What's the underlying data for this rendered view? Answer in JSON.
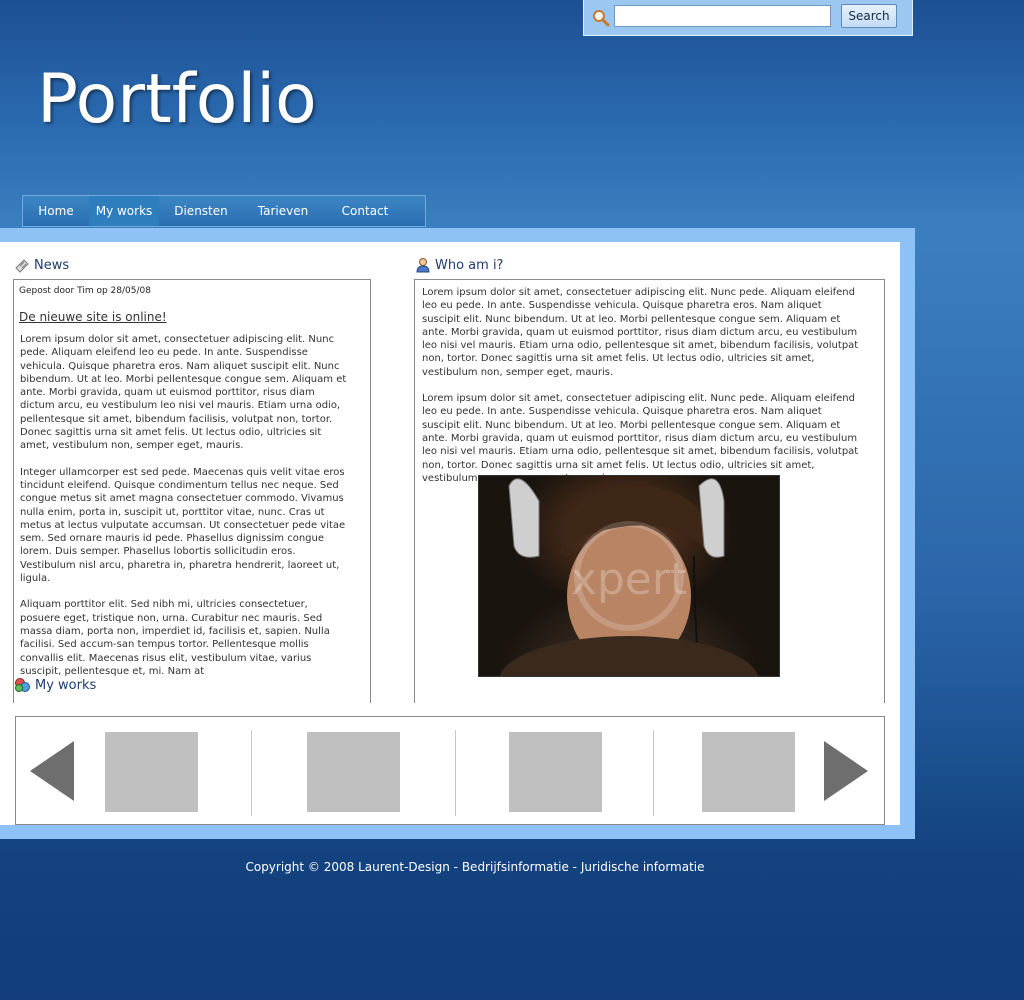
{
  "search": {
    "placeholder": "",
    "value": "",
    "button_label": "Search"
  },
  "site": {
    "title": "Portfolio"
  },
  "nav": {
    "items": [
      {
        "label": "Home"
      },
      {
        "label": "My works"
      },
      {
        "label": "Diensten"
      },
      {
        "label": "Tarieven"
      },
      {
        "label": "Contact"
      }
    ],
    "active": "My works"
  },
  "news": {
    "title": "News",
    "meta": "Gepost door Tim op 28/05/08",
    "headline": "De nieuwe site is online!",
    "paragraphs": [
      "Lorem ipsum dolor sit amet, consectetuer adipiscing elit. Nunc pede. Aliquam eleifend leo eu pede. In ante. Suspendisse vehicula. Quisque pharetra eros. Nam aliquet suscipit elit. Nunc bibendum. Ut at leo. Morbi pellentesque congue sem. Aliquam et ante. Morbi gravida, quam ut euismod porttitor, risus diam dictum arcu, eu vestibulum leo nisi vel mauris. Etiam urna odio, pellentesque sit amet, bibendum facilisis, volutpat non, tortor. Donec sagittis urna sit amet felis. Ut lectus odio, ultricies sit amet, vestibulum non, semper eget, mauris.",
      "Integer ullamcorper est sed pede. Maecenas quis velit vitae eros tincidunt eleifend. Quisque condimentum tellus nec neque. Sed congue metus sit amet magna consectetuer commodo. Vivamus nulla enim, porta in, suscipit ut, porttitor vitae, nunc. Cras ut metus at lectus vulputate accumsan. Ut consectetuer pede vitae sem. Sed ornare mauris id pede. Phasellus dignissim congue lorem. Duis semper. Phasellus lobortis sollicitudin eros. Vestibulum nisl arcu, pharetra in, pharetra hendrerit, laoreet ut, ligula.",
      "Aliquam porttitor elit. Sed nibh mi, ultricies consectetuer, posuere eget, tristique non, urna. Curabitur nec mauris. Sed massa diam, porta non, imperdiet id, facilisis et, sapien. Nulla facilisi. Sed accum-san tempus tortor. Pellentesque mollis convallis elit. Maecenas risus elit, vestibulum vitae, varius suscipit, pellentesque et, mi. Nam at"
    ]
  },
  "who": {
    "title": "Who am i?",
    "paragraphs": [
      "Lorem ipsum dolor sit amet, consectetuer adipiscing elit. Nunc pede. Aliquam eleifend leo eu pede. In ante. Suspendisse vehicula. Quisque pharetra eros. Nam aliquet suscipit elit. Nunc bibendum. Ut at leo. Morbi pellentesque congue sem. Aliquam et ante. Morbi gravida, quam ut euismod porttitor, risus diam dictum arcu, eu vestibulum leo nisi vel mauris. Etiam urna odio, pellentesque sit amet, bibendum facilisis, volutpat non, tortor. Donec sagittis urna sit amet felis. Ut lectus odio, ultricies sit amet, vestibulum non, semper eget, mauris.",
      "Lorem ipsum dolor sit amet, consectetuer adipiscing elit. Nunc pede. Aliquam eleifend leo eu pede. In ante. Suspendisse vehicula. Quisque pharetra eros. Nam aliquet suscipit elit. Nunc bibendum. Ut at leo. Morbi pellentesque congue sem. Aliquam et ante. Morbi gravida, quam ut euismod porttitor, risus diam dictum arcu, eu vestibulum leo nisi vel mauris. Etiam urna odio, pellentesque sit amet, bibendum facilisis, volutpat non, tortor. Donec sagittis urna sit amet felis. Ut lectus odio, ultricies sit amet, vestibulum non, semper eget, mauris."
    ],
    "photo_watermark": "xpert"
  },
  "works": {
    "title": "My works"
  },
  "footer": {
    "copyright": "Copyright © 2008 Laurent-Design",
    "sep": " - ",
    "link1": "Bedrijfsinformatie",
    "link2": "Juridische informatie"
  },
  "colors": {
    "panel_border": "#8ec1f6",
    "nav_bg": "#2a6eb0",
    "nav_active": "#2e7ebd",
    "heading_text": "#1f3d6e",
    "thumb_placeholder": "#c0c0c0",
    "arrow": "#6e6e6e"
  }
}
